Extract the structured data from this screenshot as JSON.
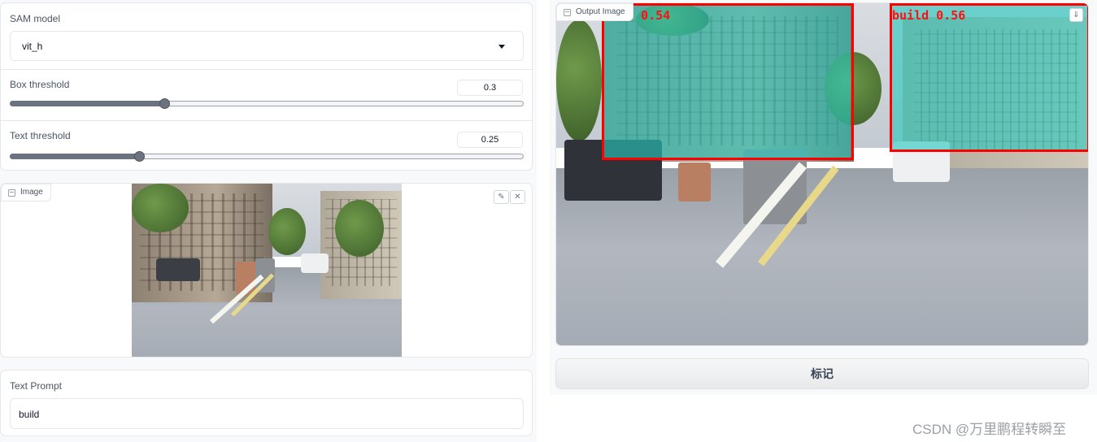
{
  "settings": {
    "model": {
      "label": "SAM model",
      "value": "vit_h"
    },
    "box_threshold": {
      "label": "Box threshold",
      "value": "0.3",
      "fraction": 0.3
    },
    "text_threshold": {
      "label": "Text threshold",
      "value": "0.25",
      "fraction": 0.25
    }
  },
  "input_image": {
    "label": "Image"
  },
  "text_prompt": {
    "label": "Text Prompt",
    "value": "build"
  },
  "output_image": {
    "label": "Output Image",
    "detections": [
      {
        "label": "d 0.54"
      },
      {
        "label": "build 0.56"
      }
    ]
  },
  "submit_button": {
    "label": "标记"
  },
  "watermark": "CSDN @万里鹏程转瞬至",
  "colors": {
    "box": "#ff0000",
    "mask": "#28c8be",
    "slider": "#6b7280"
  },
  "icons": [
    "image-icon",
    "edit-icon",
    "clear-icon",
    "download-icon",
    "chevron-down-icon"
  ]
}
